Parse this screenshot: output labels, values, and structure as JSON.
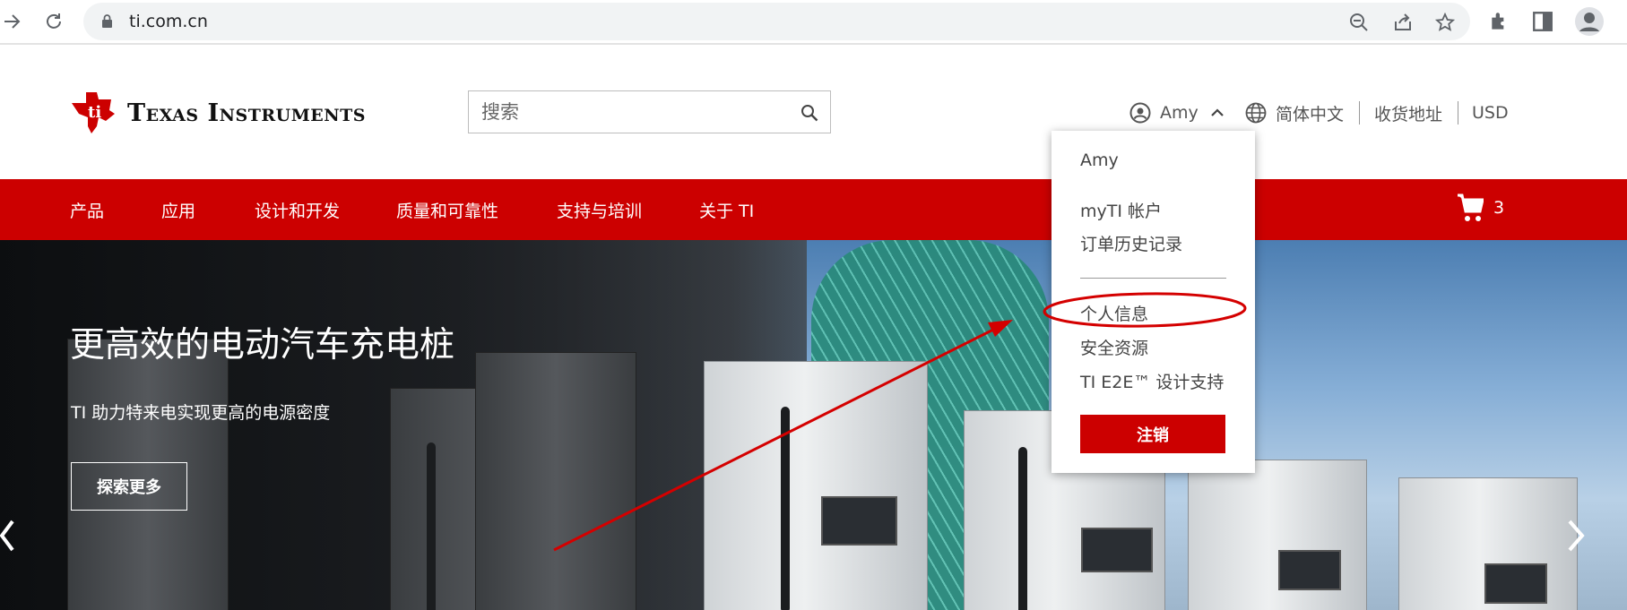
{
  "browser": {
    "url": "ti.com.cn",
    "icons": [
      "forward-icon",
      "reload-icon",
      "lock-icon",
      "zoom-out-icon",
      "share-icon",
      "star-icon",
      "extensions-icon",
      "side-panel-icon",
      "profile-icon"
    ]
  },
  "header": {
    "logo_text": "Texas Instruments",
    "search_placeholder": "搜索",
    "user_name": "Amy",
    "language": "简体中文",
    "shipping": "收货地址",
    "currency": "USD"
  },
  "nav": {
    "items": [
      "产品",
      "应用",
      "设计和开发",
      "质量和可靠性",
      "支持与培训",
      "关于 TI"
    ],
    "cart_count": "3"
  },
  "hero": {
    "title": "更高效的电动汽车充电桩",
    "subtitle": "TI 助力特来电实现更高的电源密度",
    "button": "探索更多"
  },
  "user_menu": {
    "name": "Amy",
    "items": [
      "myTI 帐户",
      "订单历史记录",
      "个人信息",
      "安全资源",
      "TI E2E™ 设计支持"
    ],
    "logout": "注销"
  },
  "colors": {
    "brand_red": "#cc0000",
    "annotation_red": "#d40000"
  }
}
